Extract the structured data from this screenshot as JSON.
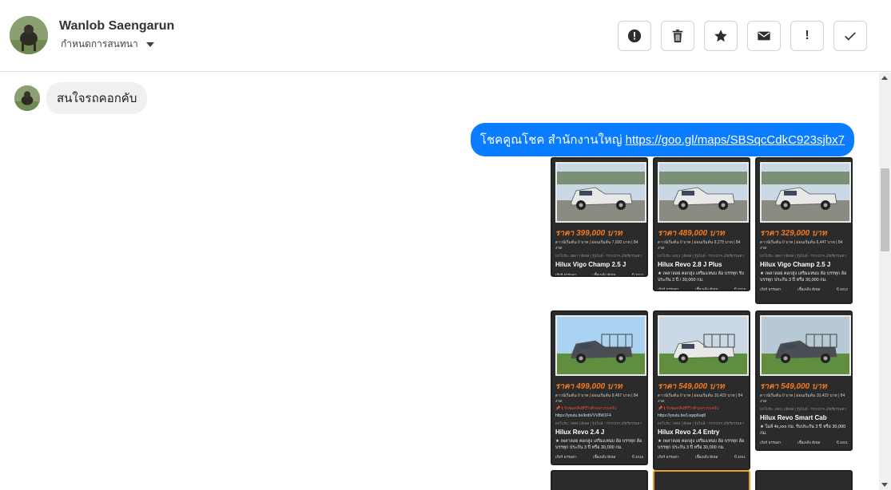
{
  "header": {
    "name": "Wanlob Saengarun",
    "label_dropdown": "กำหนดการสนทนา"
  },
  "toolbar": {
    "buttons": [
      {
        "name": "alert-icon",
        "title": "spam"
      },
      {
        "name": "trash-icon",
        "title": "delete"
      },
      {
        "name": "star-icon",
        "title": "star"
      },
      {
        "name": "envelope-icon",
        "title": "unread"
      },
      {
        "name": "exclamation-icon",
        "title": "important",
        "glyph": "!"
      },
      {
        "name": "check-icon",
        "title": "done",
        "glyph": "✓"
      }
    ]
  },
  "messages": {
    "incoming_text": "สนใจรถคอกคับ",
    "outgoing_prefix": "โชคคูณโชค สำนักงานใหญ่ ",
    "outgoing_link": "https://goo.gl/maps/SBSqcCdkC923sjbx7"
  },
  "cards": [
    {
      "price": "ราคา 399,000 บาท",
      "finance": "ดาวน์เริ่มต้น 0 บาท | ผ่อนเริ่มต้น 7,600 บาท | 84 งวด",
      "meta": "ยกโปรบ. 3867 | ดีเซล | รุ่นไมล์ - TOYOTA เกียร์ธรรมดา",
      "title": "Hilux Vigo Champ 2.5 J",
      "desc": "",
      "foot_left": "เกียร์ ธรรมดา",
      "foot_mid": "เชื้อเพลิง ดีเซล",
      "foot_right": "ปี 2013",
      "photo": "white-pickup"
    },
    {
      "price": "ราคา 489,000 บาท",
      "finance": "ดาวน์เริ่มต้น 0 บาท | ผ่อนเริ่มต้น 9,275 บาท | 84 งวด",
      "meta": "ยกโปรบ. 5012 | ดีเซล | รุ่นไมล์ - TOYOTA เกียร์ธรรมดา",
      "title": "Hilux Revo 2.8 J Plus",
      "desc": "★ เพลาลอย คอกสูง เสริมแหนบ ล้อ บรรทุก รับประกัน 3 ปี / 30,000 กม.",
      "foot_left": "เกียร์ ธรรมดา",
      "foot_mid": "เชื้อเพลิง ดีเซล",
      "foot_right": "ปี 2019",
      "photo": "white-pickup"
    },
    {
      "price": "ราคา 329,000 บาท",
      "finance": "ดาวน์เริ่มต้น 0 บาท | ผ่อนเริ่มต้น 6,447 บาท | 84 งวด",
      "meta": "ยกโปรบ. 4897 | ดีเซล | รุ่นไมล์ - TOYOTA เกียร์ธรรมดา",
      "title": "Hilux Vigo Champ 2.5 J",
      "desc": "★ เพลาลอย คอกสูง เสริมแหนบ ล้อ บรรทุก ล้อบรรทุก ประกัน 3 ปี หรือ 30,000 กม.",
      "foot_left": "เกียร์ ธรรมดา",
      "foot_mid": "เชื้อเพลิง ดีเซล",
      "foot_right": "ปี 2012",
      "photo": "white-pickup"
    },
    {
      "price": "ราคา 499,000 บาท",
      "finance": "ดาวน์เริ่มต้น 0 บาท | ผ่อนเริ่มต้น 9,467 บาท | 84 งวด",
      "meta": "ยกโปรบ. 7980 | ดีเซล | รุ่นไมล์ - TOYOTA เกียร์ธรรมดา",
      "title": "Hilux Revo 2.4 J",
      "desc": "★ เพลาลอย คอกสูง เสริมแหนบ ล้อ บรรทุก ล้อบรรทุก ประกัน 3 ปี หรือ 30,000 กม.",
      "link_line": "📌 ℹ รับชมคลิปที่รีวิวตัวอย่างรถครับ",
      "yt_line": "https://youtu.be/kobVVV8W1F4",
      "foot_left": "เกียร์ ธรรมดา",
      "foot_mid": "เชื้อเพลิง ดีเซล",
      "foot_right": "ปี 2018",
      "photo": "dark-pickup"
    },
    {
      "price": "ราคา 549,000 บาท",
      "finance": "ดาวน์เริ่มต้น 0 บาท | ผ่อนเริ่มต้น 10,415 บาท | 84 งวด",
      "meta": "ยกโปรบ. 7983 | ดีเซล | รุ่นไมล์ - TOYOTA เกียร์ธรรมดา",
      "title": "Hilux Revo 2.4 Entry",
      "desc": "★ เพลาลอย คอกสูง เสริมแหนบ ล้อ บรรทุก ล้อบรรทุก ประกัน 3 ปี หรือ 30,000 กม.",
      "link_line": "📌 ℹ รับชมคลิปที่รีวิวตัวอย่างรถครับ",
      "yt_line": "https://youtu.be/Lsqxp6uq8",
      "foot_left": "เกียร์ ธรรมดา",
      "foot_mid": "เชื้อเพลิง ดีเซล",
      "foot_right": "ปี 2021",
      "photo": "white-pickup"
    },
    {
      "price": "ราคา 549,000 บาท",
      "finance": "ดาวน์เริ่มต้น 0 บาท | ผ่อนเริ่มต้น 10,415 บาท | 84 งวด",
      "meta": "ยกโปรบ. 2901 | ดีเซล | รุ่นไมล์ - TOYOTA เกียร์ธรรมดา",
      "title": "Hilux Revo Smart Cab",
      "desc": "★ ไมล์ 4x,xxx กม. รับประกัน 3 ปี หรือ 30,000 กม.",
      "foot_left": "เกียร์ ธรรมดา",
      "foot_mid": "เชื้อเพลิง ดีเซล",
      "foot_right": "ปี 2021",
      "photo": "dark-pickup"
    }
  ]
}
